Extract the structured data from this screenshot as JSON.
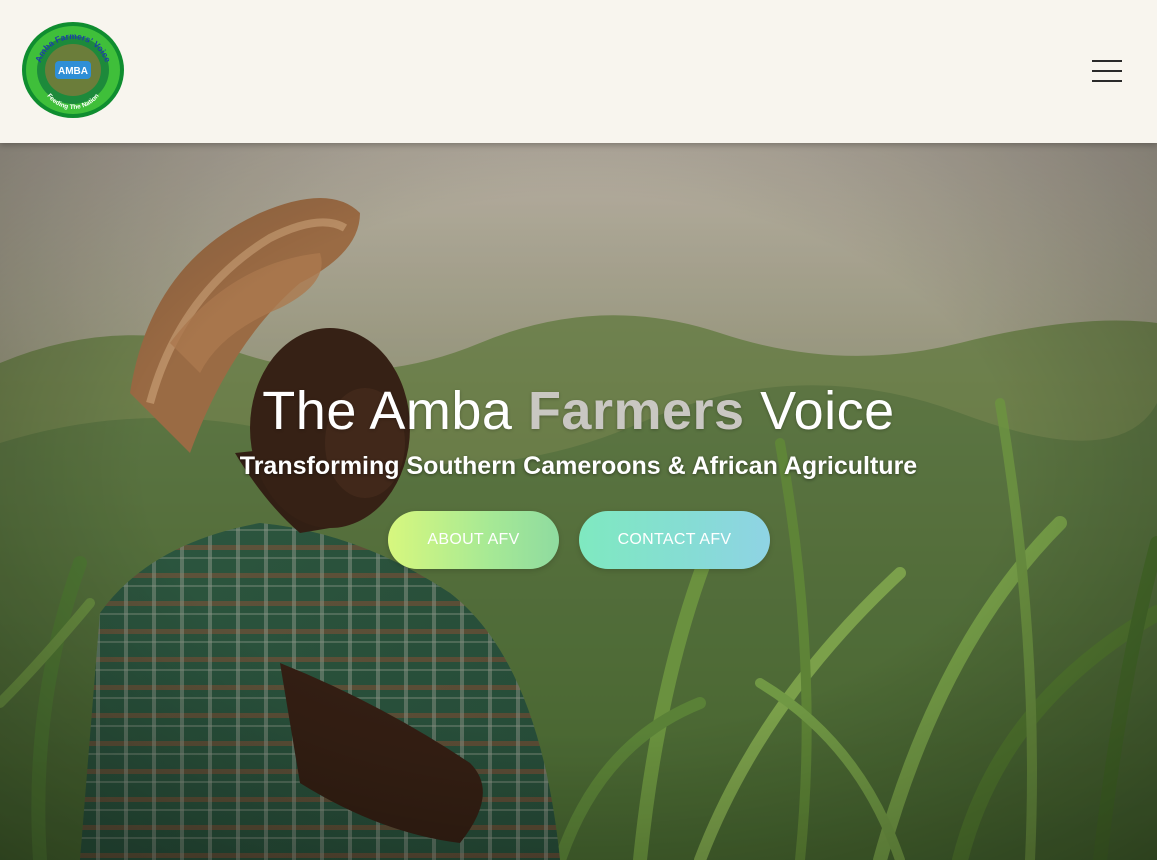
{
  "header": {
    "logo": {
      "top_text": "Amba Farmers' Voice",
      "center_text": "AMBA",
      "bottom_text": "Feeding The Nation",
      "ring_color": "#1fa43a",
      "inner_color": "#2f8fd6"
    },
    "menu_icon": "hamburger-menu-icon"
  },
  "hero": {
    "title_part1": "The Amba ",
    "title_accent": "Farmers",
    "title_part2": " Voice",
    "subtitle": "Transforming Southern Cameroons & African Agriculture",
    "buttons": {
      "about": "ABOUT AFV",
      "contact": "CONTACT AFV"
    },
    "colors": {
      "about_gradient_start": "#d7f77e",
      "about_gradient_end": "#8fdba0",
      "contact_gradient_start": "#7fe9c0",
      "contact_gradient_end": "#8fd3e4"
    }
  }
}
